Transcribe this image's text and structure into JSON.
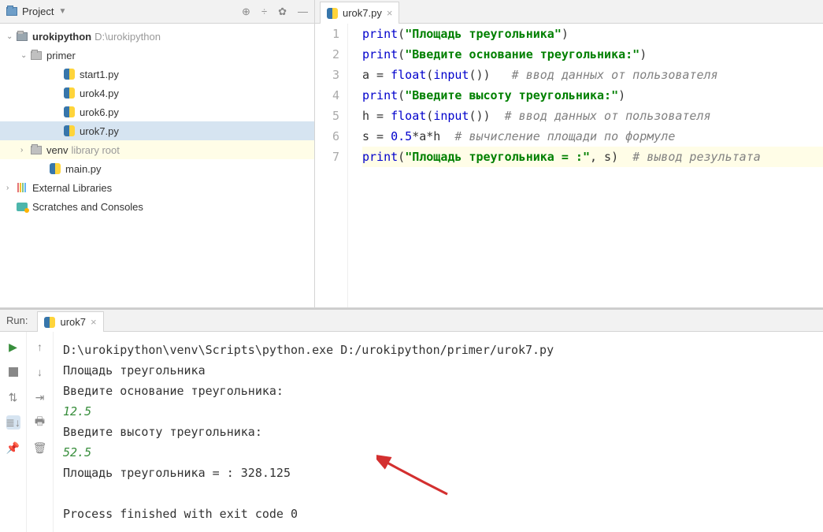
{
  "project_header": {
    "title": "Project"
  },
  "tree": {
    "root": {
      "name": "urokipython",
      "path": "D:\\urokipython"
    },
    "primer": "primer",
    "files": [
      "start1.py",
      "urok4.py",
      "urok6.py",
      "urok7.py"
    ],
    "venv": {
      "name": "venv",
      "hint": "library root"
    },
    "main": "main.py",
    "external": "External Libraries",
    "scratches": "Scratches and Consoles"
  },
  "tab": {
    "name": "urok7.py"
  },
  "code": {
    "lines": [
      "1",
      "2",
      "3",
      "4",
      "5",
      "6",
      "7"
    ],
    "l1": {
      "fn": "print",
      "s": "\"Площадь треугольника\""
    },
    "l2": {
      "fn": "print",
      "s": "\"Введите основание треугольника:\""
    },
    "l3": {
      "a": "a = ",
      "f1": "float",
      "f2": "input",
      "p": "()",
      "c": "# ввод данных от пользователя"
    },
    "l4": {
      "fn": "print",
      "s": "\"Введите высоту треугольника:\""
    },
    "l5": {
      "a": "h = ",
      "f1": "float",
      "f2": "input",
      "p": "()",
      "c": "# ввод данных от пользователя"
    },
    "l6": {
      "a": "s = ",
      "n": "0.5",
      "rest": "*a*h",
      "c": "# вычисление площади по формуле"
    },
    "l7": {
      "fn": "print",
      "s": "\"Площадь треугольника = :\"",
      "rest": ", s)",
      "c": "# вывод результата"
    }
  },
  "run": {
    "label": "Run:",
    "tab": "urok7",
    "cmd": "D:\\urokipython\\venv\\Scripts\\python.exe D:/urokipython/primer/urok7.py",
    "o1": "Площадь треугольника",
    "o2": "Введите основание треугольника:",
    "i1": "12.5",
    "o3": "Введите высоту треугольника:",
    "i2": "52.5",
    "o4": "Площадь треугольника = : 328.125",
    "exit": "Process finished with exit code 0"
  }
}
